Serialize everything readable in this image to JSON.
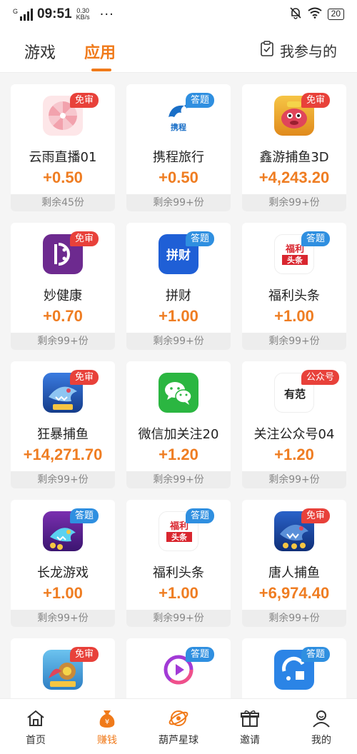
{
  "status_bar": {
    "network": "G",
    "time": "09:51",
    "speed_value": "0.30",
    "speed_unit": "KB/s",
    "dots": "···",
    "battery": "20"
  },
  "tabs": [
    {
      "label": "游戏"
    },
    {
      "label": "应用"
    }
  ],
  "my_participation": "我参与的",
  "cards": [
    {
      "name": "云雨直播01",
      "reward": "+0.50",
      "remaining": "剩余45份",
      "badge": "免审"
    },
    {
      "name": "携程旅行",
      "reward": "+0.50",
      "remaining": "剩余99+份",
      "badge": "答题",
      "icon_text": "携程"
    },
    {
      "name": "鑫游捕鱼3D",
      "reward": "+4,243.20",
      "remaining": "剩余99+份",
      "badge": "免审"
    },
    {
      "name": "妙健康",
      "reward": "+0.70",
      "remaining": "剩余99+份",
      "badge": "免审"
    },
    {
      "name": "拼财",
      "reward": "+1.00",
      "remaining": "剩余99+份",
      "badge": "答题",
      "icon_text": "拼财"
    },
    {
      "name": "福利头条",
      "reward": "+1.00",
      "remaining": "剩余99+份",
      "badge": "答题",
      "icon_text": "福利",
      "icon_text2": "头条"
    },
    {
      "name": "狂暴捕鱼",
      "reward": "+14,271.70",
      "remaining": "剩余99+份",
      "badge": "免审"
    },
    {
      "name": "微信加关注20",
      "reward": "+1.20",
      "remaining": "剩余99+份"
    },
    {
      "name": "关注公众号04",
      "reward": "+1.20",
      "remaining": "剩余99+份",
      "badge": "公众号",
      "icon_text": "有范"
    },
    {
      "name": "长龙游戏",
      "reward": "+1.00",
      "remaining": "剩余99+份",
      "badge": "答题"
    },
    {
      "name": "福利头条",
      "reward": "+1.00",
      "remaining": "剩余99+份",
      "badge": "答题",
      "icon_text": "福利",
      "icon_text2": "头条"
    },
    {
      "name": "唐人捕鱼",
      "reward": "+6,974.40",
      "remaining": "剩余99+份",
      "badge": "免审"
    },
    {
      "badge": "免审"
    },
    {
      "badge": "答题"
    },
    {
      "badge": "答题"
    }
  ],
  "bottom_nav": [
    {
      "label": "首页"
    },
    {
      "label": "赚钱"
    },
    {
      "label": "葫芦星球"
    },
    {
      "label": "邀请"
    },
    {
      "label": "我的"
    }
  ],
  "colors": {
    "accent": "#f07a1a",
    "reward": "#ef7d22",
    "badge_red": "#e8413a",
    "badge_blue": "#2f8fe0"
  }
}
